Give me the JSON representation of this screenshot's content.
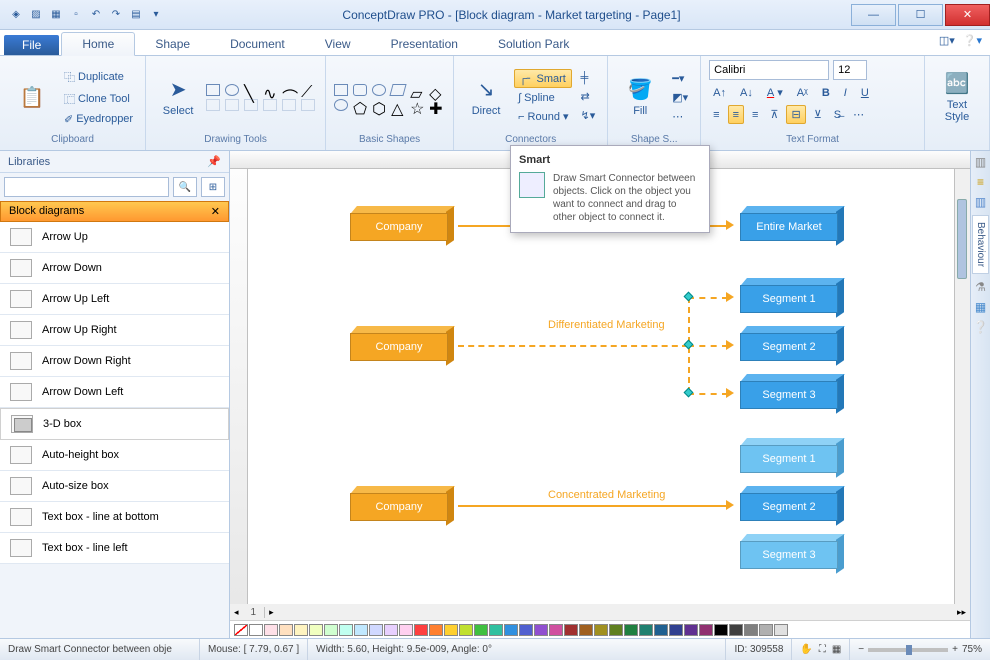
{
  "title": "ConceptDraw PRO - [Block diagram - Market targeting - Page1]",
  "tabs": {
    "file": "File",
    "home": "Home",
    "shape": "Shape",
    "document": "Document",
    "view": "View",
    "presentation": "Presentation",
    "solution_park": "Solution Park"
  },
  "ribbon": {
    "clipboard": {
      "duplicate": "Duplicate",
      "clone": "Clone Tool",
      "eyedropper": "Eyedropper",
      "label": "Clipboard"
    },
    "drawing": {
      "select": "Select",
      "label": "Drawing Tools"
    },
    "shapes": {
      "label": "Basic Shapes"
    },
    "connectors": {
      "direct": "Direct",
      "smart": "Smart",
      "spline": "Spline",
      "round": "Round",
      "label": "Connectors"
    },
    "shape_style": {
      "fill": "Fill",
      "label": "Shape S..."
    },
    "text_format": {
      "font": "Calibri",
      "size": "12",
      "label": "Text Format"
    },
    "text_style": {
      "label": "Text\nStyle"
    }
  },
  "library": {
    "header": "Libraries",
    "category": "Block diagrams",
    "items": [
      "Arrow Up",
      "Arrow Down",
      "Arrow Up Left",
      "Arrow Up Right",
      "Arrow Down Right",
      "Arrow Down Left",
      "3-D box",
      "Auto-height box",
      "Auto-size box",
      "Text box - line at bottom",
      "Text box - line left"
    ]
  },
  "canvas": {
    "blocks_left": {
      "b1": "Company",
      "b2": "Company",
      "b3": "Company"
    },
    "blocks_right_1": "Entire Market",
    "labels": {
      "diff": "Differentiated Marketing",
      "conc": "Concentrated Marketing"
    },
    "segments2": [
      "Segment 1",
      "Segment 2",
      "Segment 3"
    ],
    "segments3": [
      "Segment 1",
      "Segment 2",
      "Segment 3"
    ],
    "page_tab": "1"
  },
  "tooltip": {
    "title": "Smart",
    "body": "Draw Smart Connector between objects. Click on the object you want to connect and drag to other object to connect it."
  },
  "rightbar": {
    "behaviour": "Behaviour"
  },
  "status": {
    "hint": "Draw Smart Connector between obje",
    "mouse": "Mouse: [ 7.79, 0.67 ]",
    "dims": "Width: 5.60,  Height: 9.5e-009,  Angle: 0°",
    "id": "ID: 309558",
    "zoom": "75%"
  },
  "colors": [
    "#ffffff",
    "#ffe0e8",
    "#ffe0c0",
    "#fff4c0",
    "#f0ffc0",
    "#d0ffd0",
    "#c0fff0",
    "#c0e8ff",
    "#d0d8ff",
    "#e8d0ff",
    "#ffd0f0",
    "#ff4040",
    "#ff8030",
    "#ffd030",
    "#c0e030",
    "#40c040",
    "#30c0a0",
    "#3090e0",
    "#5060d0",
    "#9050d0",
    "#d050a0",
    "#a03030",
    "#a06020",
    "#a09020",
    "#608020",
    "#208040",
    "#208070",
    "#206090",
    "#304090",
    "#603090",
    "#903070",
    "#000000",
    "#404040",
    "#808080",
    "#b0b0b0",
    "#e0e0e0"
  ]
}
